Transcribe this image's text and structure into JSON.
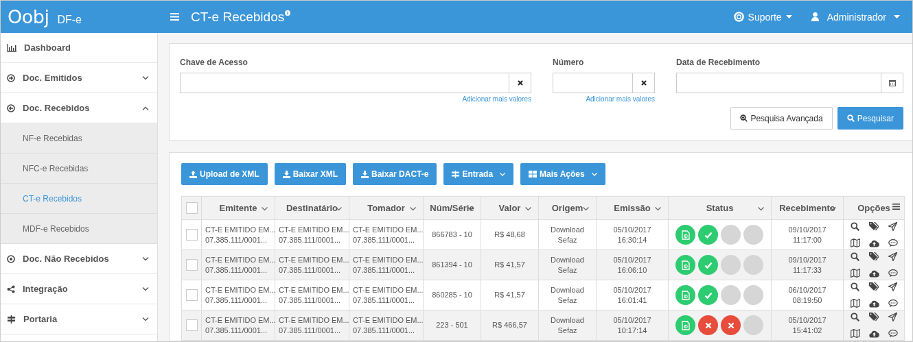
{
  "header": {
    "logo": "Oobj",
    "product": "DF-e",
    "title": "CT-e Recebidos",
    "support": "Suporte",
    "user": "Administrador"
  },
  "sidebar": {
    "items": [
      {
        "label": "Dashboard"
      },
      {
        "label": "Doc. Emitidos",
        "expanded": false
      },
      {
        "label": "Doc. Recebidos",
        "expanded": true,
        "children": [
          {
            "label": "NF-e Recebidas",
            "selected": false
          },
          {
            "label": "NFC-e Recebidas",
            "selected": false
          },
          {
            "label": "CT-e Recebidos",
            "selected": true
          },
          {
            "label": "MDF-e Recebidos",
            "selected": false
          }
        ]
      },
      {
        "label": "Doc. Não Recebidos",
        "expanded": false
      },
      {
        "label": "Integração",
        "expanded": false
      },
      {
        "label": "Portaria",
        "expanded": false
      }
    ]
  },
  "filters": {
    "fields": [
      {
        "label": "Chave de Acesso",
        "kind": "clear",
        "link": "Adicionar mais valores"
      },
      {
        "label": "Número",
        "kind": "clear",
        "link": "Adicionar mais valores"
      },
      {
        "label": "Data de Recebimento",
        "kind": "date"
      }
    ],
    "buttons": [
      {
        "label": "Pesquisa Avançada",
        "kind": "default"
      },
      {
        "label": "Pesquisar",
        "kind": "primary"
      }
    ]
  },
  "toolbar": [
    {
      "label": "Upload de XML",
      "kind": "upload"
    },
    {
      "label": "Baixar XML",
      "kind": "download"
    },
    {
      "label": "Baixar DACT-e",
      "kind": "download"
    },
    {
      "label": "Entrada",
      "kind": "signs",
      "dropdown": true
    },
    {
      "label": "Mais Ações",
      "kind": "grid",
      "dropdown": true
    }
  ],
  "table": {
    "select_all_checked": false,
    "columns": [
      "Emitente",
      "Destinatário",
      "Tomador",
      "Núm/Série",
      "Valor",
      "Origem",
      "Emissão",
      "Status",
      "Recebimento",
      "Opções"
    ],
    "rows": [
      {
        "checked": false,
        "emitente": [
          "CT-E EMITIDO EM...",
          "07.385.111/0001..."
        ],
        "destinatario": [
          "CT-E EMITIDO EM...",
          "07.385.111/0001..."
        ],
        "tomador": [
          "CT-E EMITIDO EM...",
          "07.385.111/0001..."
        ],
        "numero": "866783 - 10",
        "valor": "R$ 48,68",
        "origem": [
          "Download",
          "Sefaz"
        ],
        "emissao": [
          "05/10/2017",
          "16:30:14"
        ],
        "status": [
          {
            "kind": "doc"
          },
          {
            "kind": "ok"
          },
          {
            "kind": "none"
          },
          {
            "kind": "none"
          }
        ],
        "recebimento": [
          "09/10/2017",
          "11:17:00"
        ]
      },
      {
        "checked": false,
        "emitente": [
          "CT-E EMITIDO EM...",
          "07.385.111/0001..."
        ],
        "destinatario": [
          "CT-E EMITIDO EM...",
          "07.385.111/0001..."
        ],
        "tomador": [
          "CT-E EMITIDO EM...",
          "07.385.111/0001..."
        ],
        "numero": "861394 - 10",
        "valor": "R$ 41,57",
        "origem": [
          "Download",
          "Sefaz"
        ],
        "emissao": [
          "05/10/2017",
          "16:06:10"
        ],
        "status": [
          {
            "kind": "doc"
          },
          {
            "kind": "ok"
          },
          {
            "kind": "none"
          },
          {
            "kind": "none"
          }
        ],
        "recebimento": [
          "09/10/2017",
          "11:17:33"
        ]
      },
      {
        "checked": false,
        "emitente": [
          "CT-E EMITIDO EM...",
          "07.385.111/0001..."
        ],
        "destinatario": [
          "CT-E EMITIDO EM...",
          "07.385.111/0001..."
        ],
        "tomador": [
          "CT-E EMITIDO EM...",
          "07.385.111/0001..."
        ],
        "numero": "860285 - 10",
        "valor": "R$ 41,57",
        "origem": [
          "Download",
          "Sefaz"
        ],
        "emissao": [
          "05/10/2017",
          "16:01:41"
        ],
        "status": [
          {
            "kind": "doc"
          },
          {
            "kind": "ok"
          },
          {
            "kind": "none"
          },
          {
            "kind": "none"
          }
        ],
        "recebimento": [
          "06/10/2017",
          "08:19:50"
        ]
      },
      {
        "checked": false,
        "emitente": [
          "CT-E EMITIDO EM...",
          "07.385.111/0001..."
        ],
        "destinatario": [
          "CT-E EMITIDO EM...",
          "07.385.111/0001..."
        ],
        "tomador": [
          "CT-E EMITIDO EM...",
          "07.385.111/0001..."
        ],
        "numero": "223 - 501",
        "valor": "R$ 466,57",
        "origem": [
          "Download",
          "Sefaz"
        ],
        "emissao": [
          "05/10/2017",
          "10:17:14"
        ],
        "status": [
          {
            "kind": "doc"
          },
          {
            "kind": "error"
          },
          {
            "kind": "error"
          },
          {
            "kind": "none"
          }
        ],
        "recebimento": [
          "05/10/2017",
          "15:41:02"
        ]
      }
    ]
  }
}
